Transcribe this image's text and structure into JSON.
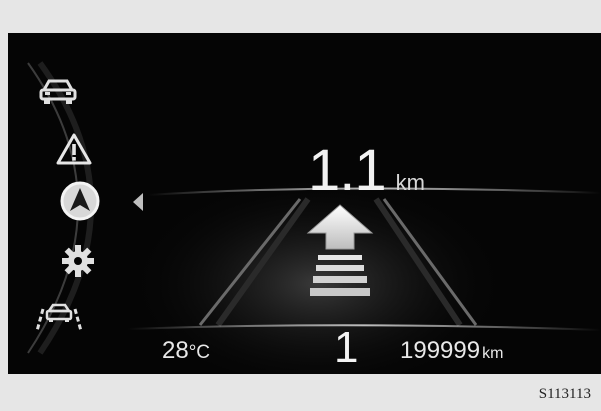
{
  "menu": {
    "items": [
      {
        "icon": "car-icon",
        "selected": false
      },
      {
        "icon": "warning-triangle-icon",
        "selected": false
      },
      {
        "icon": "navigation-icon",
        "selected": true
      },
      {
        "icon": "gear-settings-icon",
        "selected": false
      },
      {
        "icon": "lane-assist-icon",
        "selected": false
      }
    ],
    "selector_icon": "selector-arrow-icon"
  },
  "navigation": {
    "distance_value": "1.1",
    "distance_unit": "km",
    "maneuver_icon": "straight-ahead-arrow-icon"
  },
  "status": {
    "temperature_value": "28",
    "temperature_unit": "°C",
    "gear": "1",
    "odometer_value": "199999",
    "odometer_unit": "km"
  },
  "figure": {
    "caption": "S113113"
  },
  "colors": {
    "screen_background": "#050505",
    "figure_background": "#e6e6e6",
    "text": "#f2f2f2"
  }
}
